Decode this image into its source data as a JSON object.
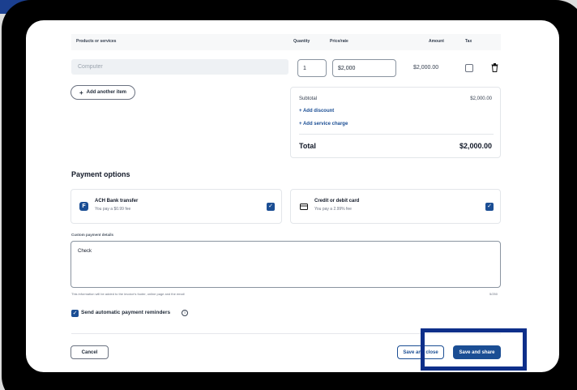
{
  "table": {
    "headers": {
      "product": "Products or services",
      "quantity": "Quantity",
      "price": "Price/rate",
      "amount": "Amount",
      "tax": "Tax"
    },
    "row": {
      "product_placeholder": "Computer",
      "quantity": "1",
      "price": "$2,000",
      "amount": "$2,000.00",
      "tax_checked": false
    },
    "add_item_label": "Add another item"
  },
  "summary": {
    "subtotal_label": "Subtotal",
    "subtotal_value": "$2,000.00",
    "add_discount": "Add discount",
    "add_service_charge": "Add service charge",
    "total_label": "Total",
    "total_value": "$2,000.00"
  },
  "payment": {
    "section_title": "Payment options",
    "options": [
      {
        "title": "ACH Bank transfer",
        "subtitle": "You pay a $0.99 fee",
        "checked": true,
        "icon": "bank-logo-icon"
      },
      {
        "title": "Credit or debit card",
        "subtitle": "You pay a 2.99% fee",
        "checked": true,
        "icon": "card-icon"
      }
    ],
    "custom_label": "Custom payment details",
    "custom_value": "Check",
    "helper_text": "This information will be added to the invoice's footer, online page and the email",
    "counter": "5/250",
    "reminders_label": "Send automatic payment reminders",
    "reminders_checked": true
  },
  "footer": {
    "cancel": "Cancel",
    "save_close": "Save and close",
    "save_share": "Save and share"
  },
  "colors": {
    "primary": "#1b4e94",
    "highlight": "#0e2f8a"
  }
}
